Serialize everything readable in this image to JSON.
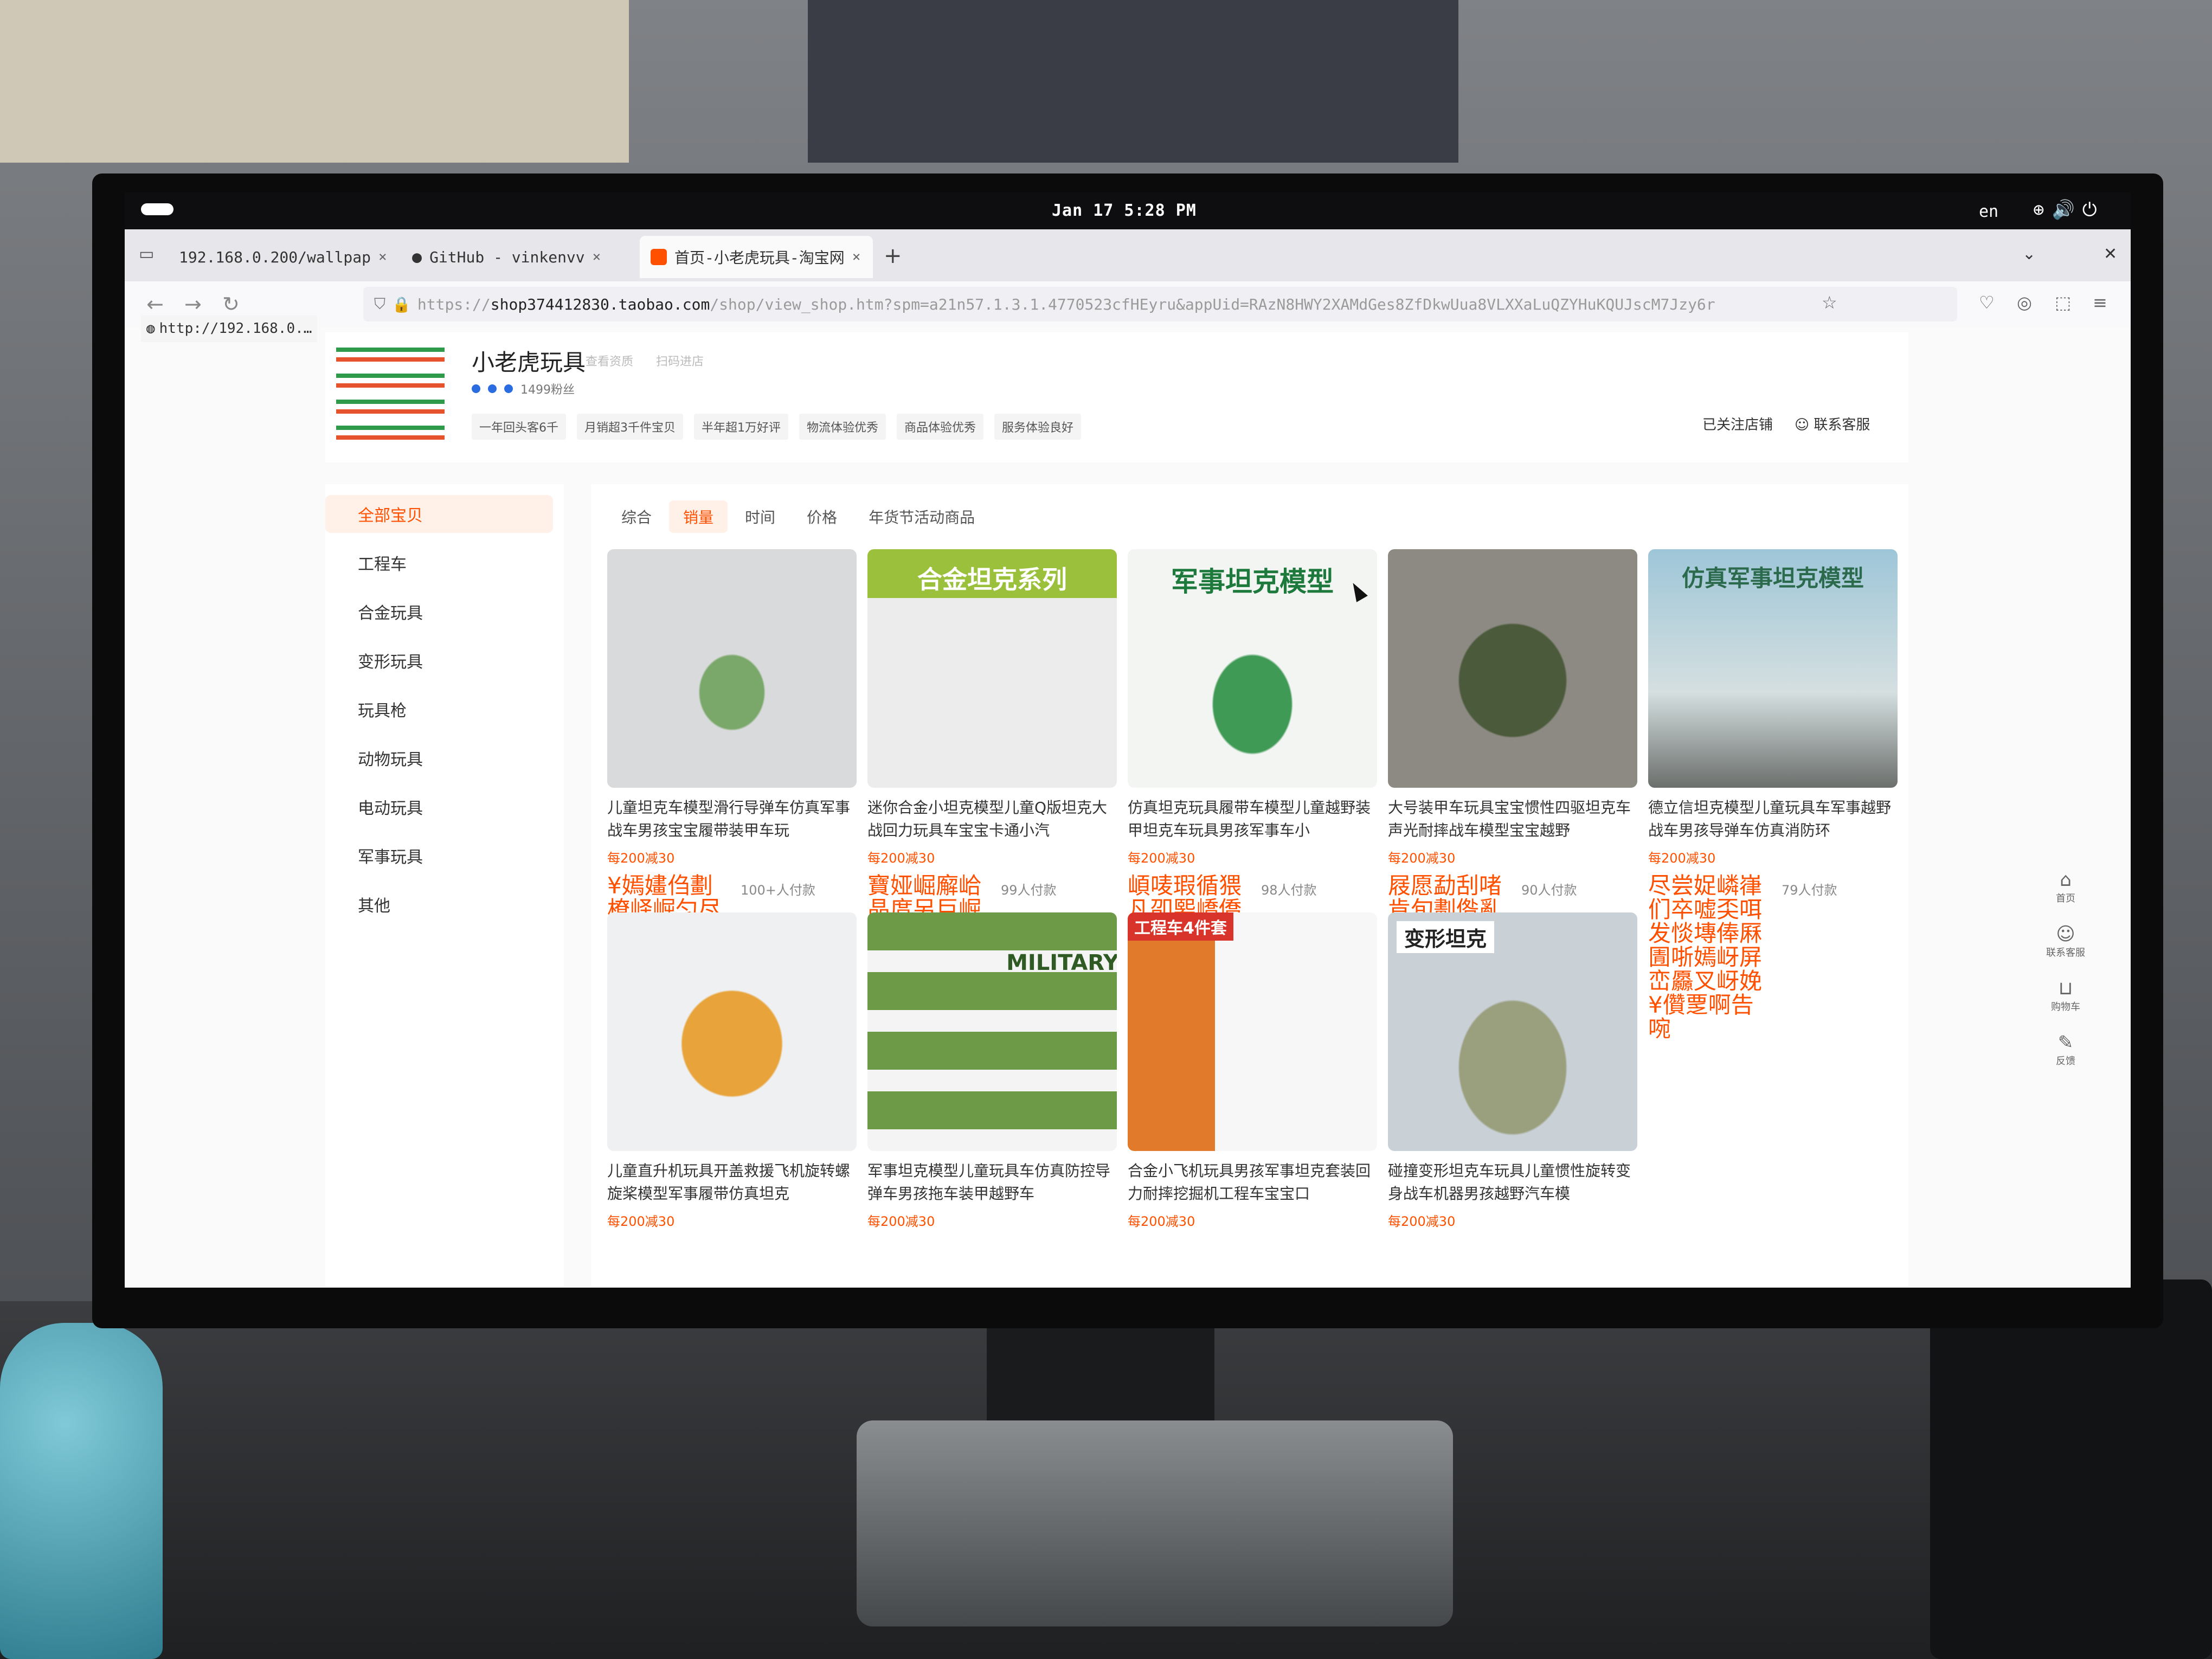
{
  "system_bar": {
    "clock": "Jan 17  5:28 PM",
    "lang": "en"
  },
  "browser": {
    "tabs": [
      {
        "label": "192.168.0.200/wallpap",
        "close": "×"
      },
      {
        "label": "GitHub - vinkenvv",
        "close": "×"
      },
      {
        "label": "首页-小老虎玩具-淘宝网",
        "close": "×"
      }
    ],
    "new_tab": "+",
    "url": {
      "scheme": "https://",
      "host": "shop374412830.taobao.com",
      "path": "/shop/view_shop.htm?spm=a21n57.1.3.1.4770523cfHEyru&appUid=RAzN8HWY2XAMdGes8ZfDkwUua8VLXXaLuQZYHuKQUJscM7Jzy6r"
    },
    "status_url": "http://192.168.0.…"
  },
  "shop": {
    "name": "小老虎玩具",
    "link_1": "查看资质",
    "link_2": "扫码进店",
    "fans": "1499粉丝",
    "tags": [
      "一年回头客6千",
      "月销超3千件宝贝",
      "半年超1万好评",
      "物流体验优秀",
      "商品体验优秀",
      "服务体验良好"
    ],
    "follow": "已关注店铺",
    "service": "联系客服"
  },
  "sidebar": {
    "items": [
      {
        "label": "全部宝贝"
      },
      {
        "label": "工程车"
      },
      {
        "label": "合金玩具"
      },
      {
        "label": "变形玩具"
      },
      {
        "label": "玩具枪"
      },
      {
        "label": "动物玩具"
      },
      {
        "label": "电动玩具"
      },
      {
        "label": "军事玩具"
      },
      {
        "label": "其他"
      }
    ]
  },
  "sort_tabs": [
    "综合",
    "销量",
    "时间",
    "价格",
    "年货节活动商品"
  ],
  "products": [
    {
      "title": "儿童坦克车模型滑行导弹车仿真军事战车男孩宝宝履带装甲车玩",
      "promo": "每200减30",
      "price": "¥嫣嫿㑇劃橑峄崛匀尽垧",
      "sold": "100+人付款",
      "sticker": ""
    },
    {
      "title": "迷你合金小坦克模型儿童Q版坦克大战回力玩具车宝宝卡通小汽",
      "promo": "每200减30",
      "price": "寶娅崛廨峆晶庹另巨崛",
      "sold": "99人付款",
      "sticker": "合金坦克系列"
    },
    {
      "title": "仿真坦克玩具履带车模型儿童越野装甲坦克车玩具男孩军事车小",
      "promo": "每200减30",
      "price": "崸唛瑕循猥凡卲媐嶠僑",
      "sold": "98人付款",
      "sticker": "军事坦克模型"
    },
    {
      "title": "大号装甲车玩具宝宝惯性四驱坦克车声光耐摔战车模型宝宝越野",
      "promo": "每200减30",
      "price": "屐愿勐刮啫肯旬劃偺亂",
      "sold": "90人付款",
      "sticker": ""
    },
    {
      "title": "德立信坦克模型儿童玩具车军事越野战车男孩导弹车仿真消防环",
      "promo": "每200减30",
      "price": "尽尝娖嶙嵂们卒嘘奀咡发惔塼俸厤圊哳嫣岈屏峦厵叉岈娩¥儹覂啊告啘",
      "sold": "79人付款",
      "sticker": "仿真军事坦克模型"
    },
    {
      "title": "儿童直升机玩具开盖救援飞机旋转螺旋桨模型军事履带仿真坦克",
      "promo": "每200减30",
      "price": "",
      "sold": "",
      "sticker": ""
    },
    {
      "title": "军事坦克模型儿童玩具车仿真防控导弹车男孩拖车装甲越野车",
      "promo": "每200减30",
      "price": "",
      "sold": "",
      "sticker": "MILITARY"
    },
    {
      "title": "合金小飞机玩具男孩军事坦克套装回力耐摔挖掘机工程车宝宝口",
      "promo": "每200减30",
      "price": "",
      "sold": "",
      "sticker": "工程车4件套"
    },
    {
      "title": "碰撞变形坦克车玩具儿童惯性旋转变身战车机器男孩越野汽车模",
      "promo": "每200减30",
      "price": "",
      "sold": "",
      "sticker": "变形坦克"
    }
  ],
  "right_float": [
    "首页",
    "联系客服",
    "购物车",
    "反馈"
  ],
  "colors": {
    "accent": "#ff5000",
    "sidebar_active_bg": "#fff1e8"
  }
}
